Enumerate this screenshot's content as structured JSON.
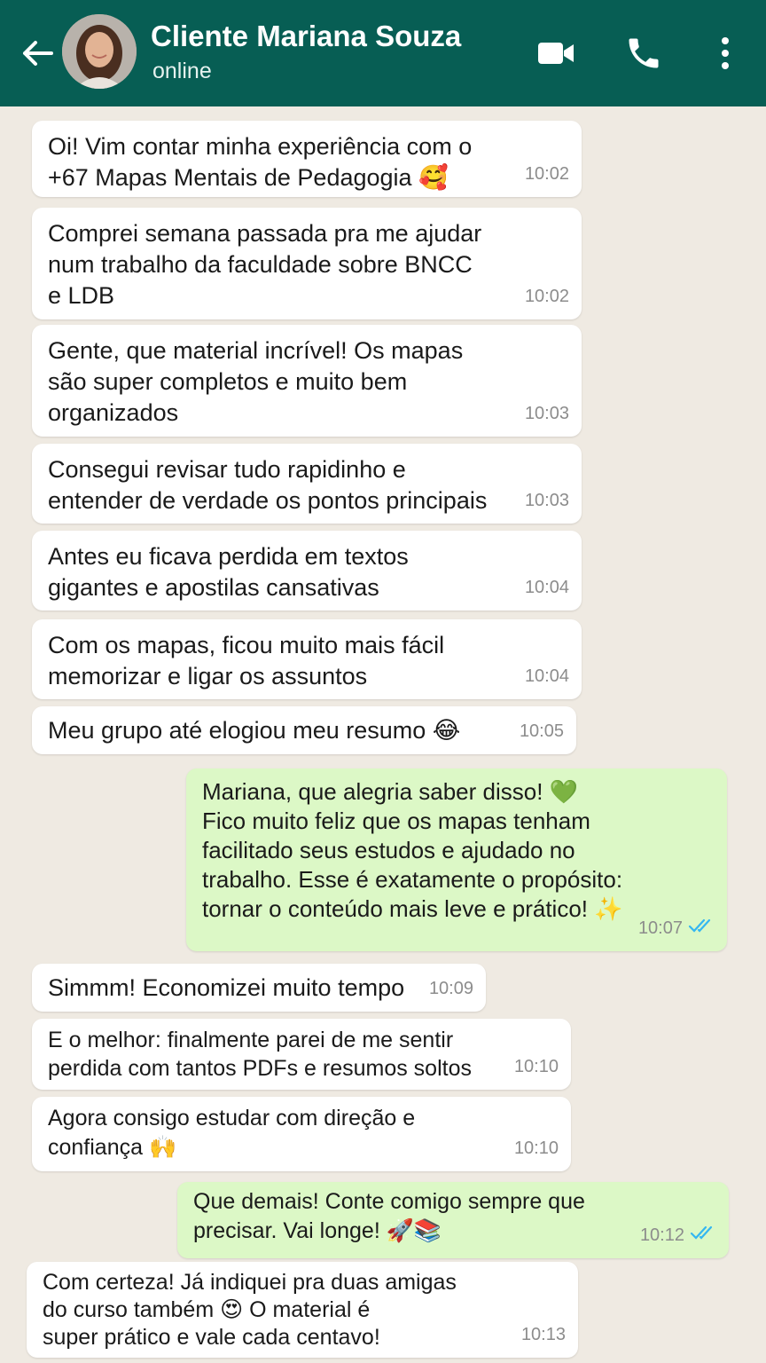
{
  "header": {
    "title": "Cliente Mariana Souza",
    "status": "online",
    "icons": [
      "back-arrow-icon",
      "video-call-icon",
      "phone-call-icon",
      "more-vert-icon"
    ]
  },
  "messages": [
    {
      "dir": "in",
      "lines": [
        "Oi! Vim contar minha experiência com o",
        "+67 Mapas Mentais de Pedagogia 🥰"
      ],
      "time": "10:02"
    },
    {
      "dir": "in",
      "lines": [
        "Comprei semana passada pra me ajudar",
        "num trabalho da faculdade sobre BNCC",
        "e LDB"
      ],
      "time": "10:02"
    },
    {
      "dir": "in",
      "lines": [
        "Gente, que material incrível! Os mapas",
        "são super completos e muito bem",
        "organizados"
      ],
      "time": "10:03"
    },
    {
      "dir": "in",
      "lines": [
        "Consegui revisar tudo rapidinho e",
        "entender de verdade os pontos principais"
      ],
      "time": "10:03"
    },
    {
      "dir": "in",
      "lines": [
        "Antes eu ficava perdida em textos",
        "gigantes e apostilas cansativas"
      ],
      "time": "10:04"
    },
    {
      "dir": "in",
      "lines": [
        "Com os mapas, ficou muito mais fácil",
        "memorizar e ligar os assuntos"
      ],
      "time": "10:04"
    },
    {
      "dir": "in",
      "lines": [
        "Meu grupo até elogiou meu resumo 😂"
      ],
      "time": "10:05"
    },
    {
      "dir": "out",
      "lines": [
        "Mariana, que alegria saber disso! 💚",
        "Fico muito feliz que os mapas tenham",
        "facilitado seus estudos e ajudado no",
        "trabalho. Esse é exatamente o propósito:",
        "tornar o conteúdo mais leve e prático! ✨"
      ],
      "time": "10:07",
      "status": "read"
    },
    {
      "dir": "in",
      "lines": [
        "Simmm! Economizei muito tempo"
      ],
      "time": "10:09"
    },
    {
      "dir": "in",
      "lines": [
        "E o melhor: finalmente parei de me sentir",
        "perdida com tantos PDFs e resumos soltos"
      ],
      "time": "10:10"
    },
    {
      "dir": "in",
      "lines": [
        "Agora consigo estudar com direção e",
        "confiança 🙌"
      ],
      "time": "10:10"
    },
    {
      "dir": "out",
      "lines": [
        "Que demais! Conte comigo sempre que",
        "precisar. Vai longe! 🚀📚"
      ],
      "time": "10:12",
      "status": "read"
    },
    {
      "dir": "in",
      "lines": [
        "Com certeza! Já indiquei pra duas amigas",
        "do curso também 😍 O material é",
        "super prático e vale cada centavo!"
      ],
      "time": "10:13"
    }
  ],
  "colors": {
    "header": "#075e54",
    "incoming": "#ffffff",
    "outgoing": "#dcf8c6",
    "read_ticks": "#34b7f1",
    "background": "#efeae2"
  }
}
